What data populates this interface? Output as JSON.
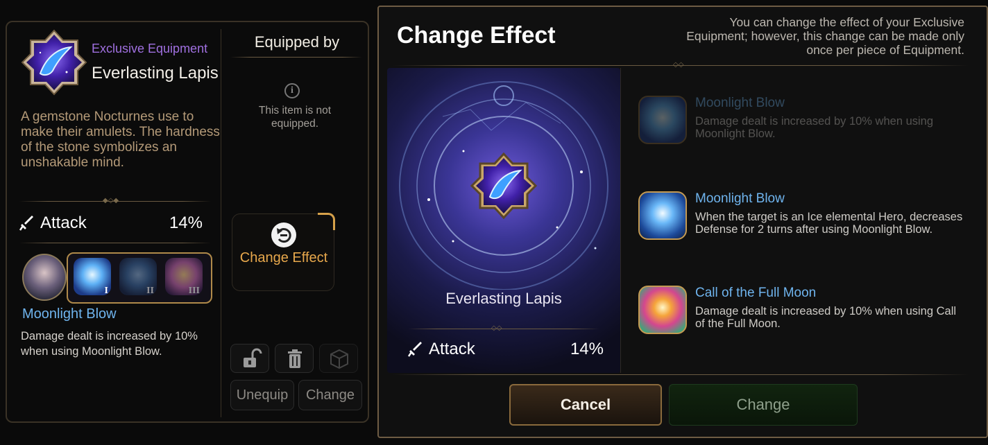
{
  "left_panel": {
    "equipment_type": "Exclusive Equipment",
    "equipment_name": "Everlasting Lapis",
    "description": "A gemstone Nocturnes use to make their amulets. The hardness of the stone symbolizes an unshakable mind.",
    "stat": {
      "label": "Attack",
      "value": "14%",
      "icon": "sword-icon"
    },
    "skills": [
      {
        "numeral": "I",
        "active": true,
        "icon": "moonlight-blow-icon"
      },
      {
        "numeral": "II",
        "active": false,
        "icon": "moonlight-blow-alt-icon"
      },
      {
        "numeral": "III",
        "active": false,
        "icon": "full-moon-icon"
      }
    ],
    "selected_skill_name": "Moonlight Blow",
    "selected_skill_desc": "Damage dealt is increased by 10% when using Moonlight Blow.",
    "equipped_by_title": "Equipped by",
    "not_equipped_text": "This item is not equipped.",
    "info_glyph": "i",
    "change_effect_label": "Change Effect",
    "unequip_label": "Unequip",
    "change_label": "Change"
  },
  "modal": {
    "title": "Change Effect",
    "note": "You can change the effect of your Exclusive Equipment; however, this change can be made only once per piece of Equipment.",
    "item_name": "Everlasting Lapis",
    "stat": {
      "label": "Attack",
      "value": "14%"
    },
    "effects": [
      {
        "title": "Moonlight Blow",
        "desc": "Damage dealt is increased by 10% when using Moonlight Blow.",
        "state": "disabled"
      },
      {
        "title": "Moonlight Blow",
        "desc": "When the target is an Ice elemental Hero, decreases Defense for 2 turns after using Moonlight Blow.",
        "state": "available"
      },
      {
        "title": "Call of the Full Moon",
        "desc": "Damage dealt is increased by 10% when using Call of the Full Moon.",
        "state": "available"
      }
    ],
    "cancel_label": "Cancel",
    "change_label": "Change"
  },
  "colors": {
    "accent_gold": "#d6a14a",
    "skill_blue": "#6fb4ee",
    "equip_purple": "#a070e0",
    "change_effect_orange": "#e8a84c"
  }
}
